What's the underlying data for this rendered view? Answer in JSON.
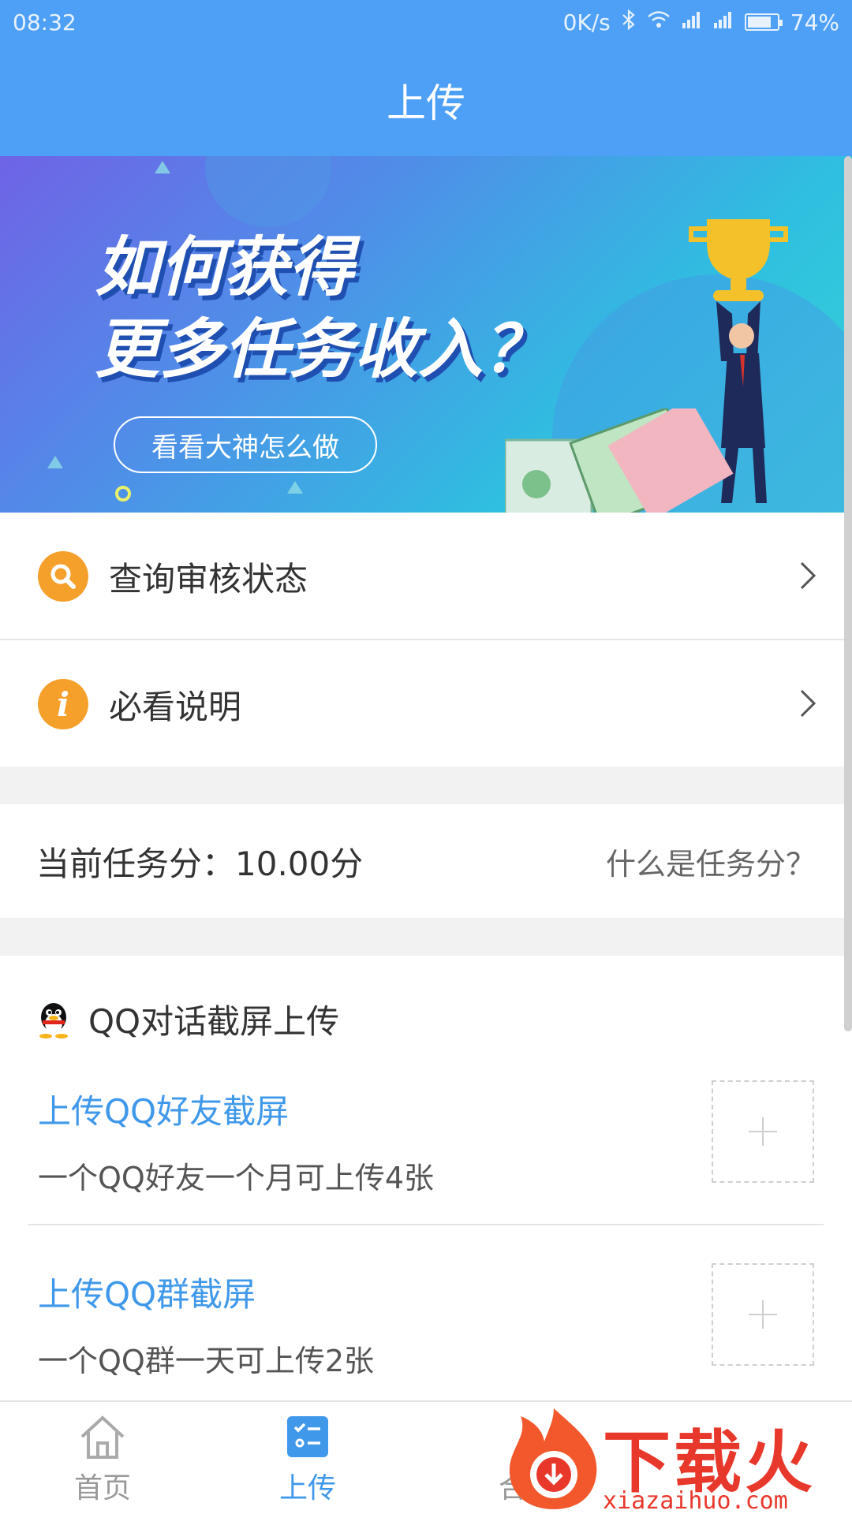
{
  "status_bar": {
    "time": "08:32",
    "net_speed": "0K/s",
    "battery": "74%",
    "icons": [
      "bluetooth-icon",
      "wifi-icon",
      "signal-icon",
      "signal-icon",
      "battery-icon"
    ]
  },
  "app_bar": {
    "title": "上传"
  },
  "banner": {
    "line1": "如何获得",
    "line2": "更多任务收入？",
    "button_label": "看看大神怎么做"
  },
  "menu": {
    "items": [
      {
        "label": "查询审核状态",
        "icon": "search-icon"
      },
      {
        "label": "必看说明",
        "icon": "info-icon"
      }
    ]
  },
  "score": {
    "label": "当前任务分：10.00分",
    "help_link": "什么是任务分？"
  },
  "qq_section": {
    "title": "QQ对话截屏上传",
    "items": [
      {
        "title": "上传QQ好友截屏",
        "desc": "一个QQ好友一个月可上传4张"
      },
      {
        "title": "上传QQ群截屏",
        "desc": "一个QQ群一天可上传2张"
      }
    ]
  },
  "tabs": [
    {
      "label": "首页",
      "icon": "home-icon",
      "active": false
    },
    {
      "label": "上传",
      "icon": "upload-list-icon",
      "active": true
    },
    {
      "label": "合",
      "icon": "",
      "active": false
    }
  ],
  "watermark": {
    "brand": "下载火",
    "url": "xiazaihuo.com"
  },
  "colors": {
    "primary": "#4da0f5",
    "link": "#3f98ea",
    "accent": "#f6a02c",
    "watermark": "#e8382b"
  }
}
